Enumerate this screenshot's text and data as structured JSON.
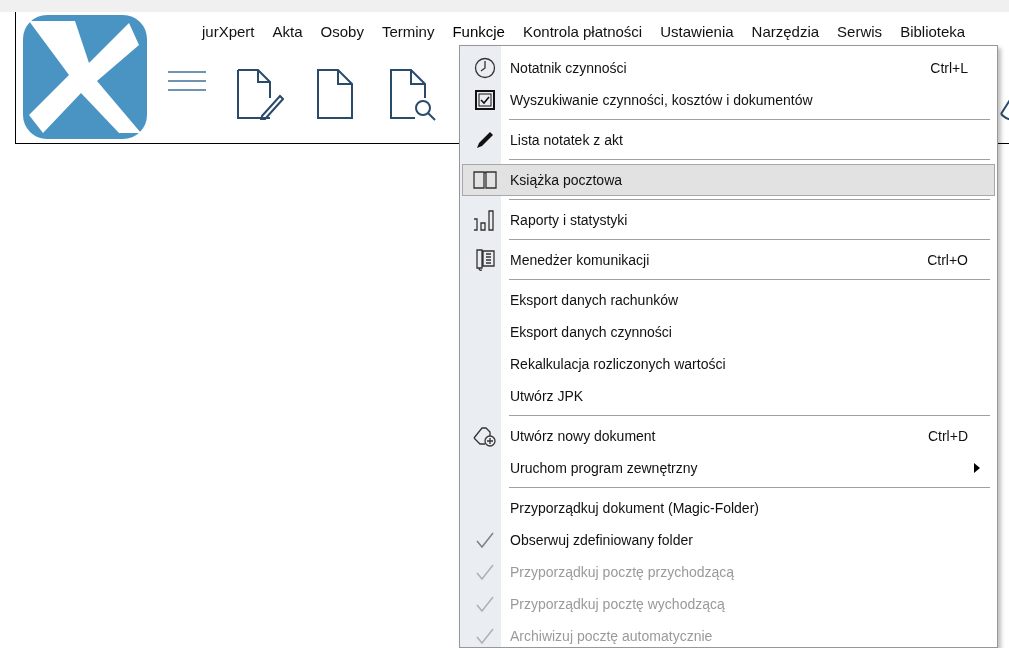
{
  "menu_bar": [
    {
      "label": "jurXpert",
      "selected": false
    },
    {
      "label": "Akta",
      "selected": false
    },
    {
      "label": "Osoby",
      "selected": false
    },
    {
      "label": "Terminy",
      "selected": false
    },
    {
      "label": "Funkcje",
      "selected": true
    },
    {
      "label": "Kontrola płatności",
      "selected": false
    },
    {
      "label": "Ustawienia",
      "selected": false
    },
    {
      "label": "Narzędzia",
      "selected": false
    },
    {
      "label": "Serwis",
      "selected": false
    },
    {
      "label": "Biblioteka",
      "selected": false
    }
  ],
  "menu": {
    "items": [
      {
        "kind": "item",
        "label": "Notatnik czynności",
        "shortcut": "Ctrl+L",
        "selected": false,
        "checked": false,
        "disabled": false
      },
      {
        "kind": "item",
        "label": "Wyszukiwanie czynności, kosztów i dokumentów",
        "selected": false,
        "checked": false,
        "disabled": false
      },
      {
        "kind": "separator"
      },
      {
        "kind": "item",
        "label": "Lista notatek z akt",
        "selected": false,
        "checked": false,
        "disabled": false
      },
      {
        "kind": "separator"
      },
      {
        "kind": "item",
        "label": "Książka pocztowa",
        "selected": true,
        "checked": false,
        "disabled": false
      },
      {
        "kind": "separator"
      },
      {
        "kind": "item",
        "label": "Raporty i statystyki",
        "selected": false,
        "checked": false,
        "disabled": false
      },
      {
        "kind": "separator"
      },
      {
        "kind": "item",
        "label": "Menedżer komunikacji",
        "shortcut": "Ctrl+O",
        "selected": false,
        "checked": false,
        "disabled": false
      },
      {
        "kind": "separator"
      },
      {
        "kind": "item",
        "label": "Eksport danych rachunków",
        "selected": false,
        "checked": false,
        "disabled": false
      },
      {
        "kind": "item",
        "label": "Eksport danych czynności",
        "selected": false,
        "checked": false,
        "disabled": false
      },
      {
        "kind": "item",
        "label": "Rekalkulacja rozliczonych wartości",
        "selected": false,
        "checked": false,
        "disabled": false
      },
      {
        "kind": "item",
        "label": "Utwórz JPK",
        "selected": false,
        "checked": false,
        "disabled": false
      },
      {
        "kind": "separator"
      },
      {
        "kind": "item",
        "label": "Utwórz nowy dokument",
        "shortcut": "Ctrl+D",
        "selected": false,
        "checked": false,
        "disabled": false
      },
      {
        "kind": "submenu",
        "label": "Uruchom program zewnętrzny",
        "selected": false,
        "checked": false,
        "disabled": false
      },
      {
        "kind": "separator"
      },
      {
        "kind": "item",
        "label": "Przyporządkuj dokument (Magic-Folder)",
        "selected": false,
        "checked": false,
        "disabled": false
      },
      {
        "kind": "item",
        "label": "Obserwuj zdefiniowany folder",
        "selected": false,
        "checked": true,
        "disabled": false
      },
      {
        "kind": "item",
        "label": "Przyporządkuj pocztę przychodzącą",
        "selected": false,
        "checked": true,
        "disabled": true
      },
      {
        "kind": "item",
        "label": "Przyporządkuj pocztę wychodzącą",
        "selected": false,
        "checked": true,
        "disabled": true
      },
      {
        "kind": "item",
        "label": "Archiwizuj pocztę automatycznie",
        "selected": false,
        "checked": true,
        "disabled": true
      }
    ]
  }
}
